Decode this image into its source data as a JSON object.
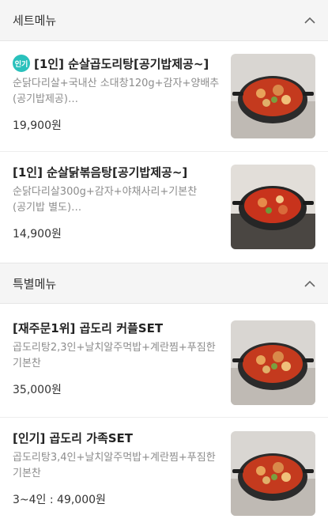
{
  "sections": [
    {
      "title": "세트메뉴",
      "items": [
        {
          "badge": "인기",
          "name": "[1인] 순살곱도리탕[공기밥제공~]",
          "desc": "순닭다리살+국내산 소대창120g+감자+양배추(공기밥제공)…",
          "price": "19,900원",
          "image": "gopdori-tang-photo"
        },
        {
          "name": "[1인] 순살닭볶음탕[공기밥제공~]",
          "desc": "순닭다리살300g+감자+야채사리+기본찬(공기밥 별도)…",
          "price": "14,900원",
          "image": "dakbokkeum-tang-photo"
        }
      ]
    },
    {
      "title": "특별메뉴",
      "items": [
        {
          "name": "[재주문1위] 곱도리 커플SET",
          "desc": "곱도리탕2,3인+날치알주먹밥+계란찜+푸짐한 기본찬",
          "price": "35,000원",
          "image": "couple-set-photo"
        },
        {
          "name": "[인기] 곱도리 가족SET",
          "desc": "곱도리탕3,4인+날치알주먹밥+계란찜+푸짐한 기본찬",
          "price": "3~4인 : 49,000원",
          "image": "family-set-photo"
        }
      ]
    }
  ],
  "icons": {
    "collapse": "chevron-up-icon"
  },
  "colors": {
    "badge": "#2ac1bc",
    "section_bg": "#f5f5f5"
  }
}
